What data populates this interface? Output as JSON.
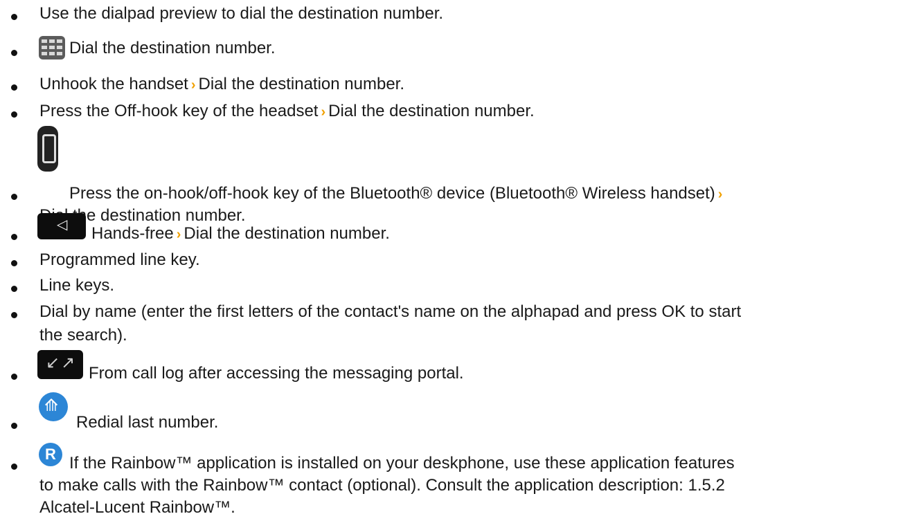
{
  "items": [
    {
      "text": "Use the dialpad preview to dial the destination number."
    },
    {
      "icon": "dialpad-icon",
      "text": "Dial the destination number."
    },
    {
      "part1": "Unhook the handset",
      "sep": "›",
      "part2": "Dial the destination number."
    },
    {
      "part1": "Press the Off-hook key of the headset",
      "sep": "›",
      "part2": "Dial the destination number."
    },
    {
      "icon": "bluetooth-handset-icon",
      "part1": "Press the on-hook/off-hook key of the Bluetooth® device (Bluetooth® Wireless handset)",
      "sep": "›",
      "part2": "Dial the destination number."
    },
    {
      "icon": "hands-free-icon",
      "part1": "Hands-free",
      "sep": "›",
      "part2": "Dial the destination number."
    },
    {
      "text": "Programmed line key."
    },
    {
      "text": "Line keys."
    },
    {
      "line1": "Dial by name (enter the first letters of the contact's name on the alphapad and press OK to start",
      "line2": "the search)."
    },
    {
      "icon": "call-log-icon",
      "text": "From call log after accessing the messaging portal."
    },
    {
      "icon": "redial-icon",
      "text": "Redial last number."
    },
    {
      "icon": "rainbow-icon",
      "icon_label": "R",
      "line1": " If the Rainbow™ application is installed on your deskphone, use these application features",
      "line2": "to make calls with the Rainbow™ contact (optional). Consult the application description: 1.5.2",
      "line3": "Alcatel-Lucent Rainbow™."
    }
  ],
  "colors": {
    "separator": "#f0a000",
    "icon_blue": "#2c86d6",
    "icon_dark": "#0d0d0d"
  }
}
